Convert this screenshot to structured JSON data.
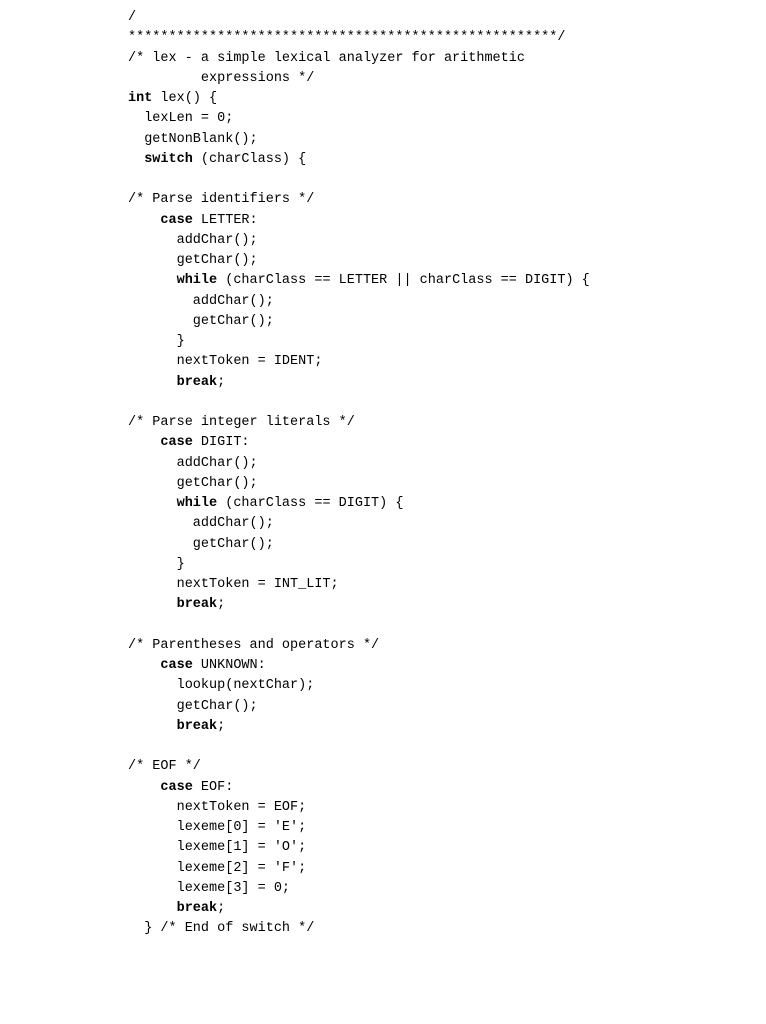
{
  "code": {
    "l01": "/",
    "l02": "*****************************************************/",
    "l03": "/* lex - a simple lexical analyzer for arithmetic",
    "l04": "         expressions */",
    "l05a": "int",
    "l05b": " lex() {",
    "l06": "  lexLen = 0;",
    "l07": "  getNonBlank();",
    "l08a": "  ",
    "l08b": "switch",
    "l08c": " (charClass) {",
    "l09": "",
    "l10": "/* Parse identifiers */",
    "l11a": "    ",
    "l11b": "case",
    "l11c": " LETTER:",
    "l12": "      addChar();",
    "l13": "      getChar();",
    "l14a": "      ",
    "l14b": "while",
    "l14c": " (charClass == LETTER || charClass == DIGIT) {",
    "l15": "        addChar();",
    "l16": "        getChar();",
    "l17": "      }",
    "l18": "      nextToken = IDENT;",
    "l19a": "      ",
    "l19b": "break",
    "l19c": ";",
    "l20": "",
    "l21": "/* Parse integer literals */",
    "l22a": "    ",
    "l22b": "case",
    "l22c": " DIGIT:",
    "l23": "      addChar();",
    "l24": "      getChar();",
    "l25a": "      ",
    "l25b": "while",
    "l25c": " (charClass == DIGIT) {",
    "l26": "        addChar();",
    "l27": "        getChar();",
    "l28": "      }",
    "l29": "      nextToken = INT_LIT;",
    "l30a": "      ",
    "l30b": "break",
    "l30c": ";",
    "l31": "",
    "l32": "/* Parentheses and operators */",
    "l33a": "    ",
    "l33b": "case",
    "l33c": " UNKNOWN:",
    "l34": "      lookup(nextChar);",
    "l35": "      getChar();",
    "l36a": "      ",
    "l36b": "break",
    "l36c": ";",
    "l37": "",
    "l38": "/* EOF */",
    "l39a": "    ",
    "l39b": "case",
    "l39c": " EOF:",
    "l40": "      nextToken = EOF;",
    "l41": "      lexeme[0] = 'E';",
    "l42": "      lexeme[1] = 'O';",
    "l43": "      lexeme[2] = 'F';",
    "l44": "      lexeme[3] = 0;",
    "l45a": "      ",
    "l45b": "break",
    "l45c": ";",
    "l46": "  } /* End of switch */"
  }
}
